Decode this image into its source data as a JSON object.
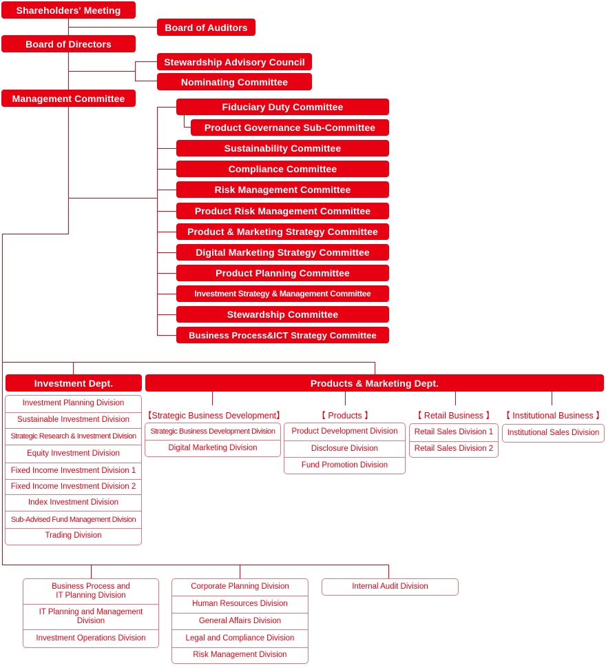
{
  "colors": {
    "accent": "#e60012",
    "line_light": "#e8757d",
    "background": "#ffffff"
  },
  "governance": {
    "shareholders": "Shareholders' Meeting",
    "auditors": "Board of Auditors",
    "directors": "Board of Directors",
    "stewardship_council": "Stewardship Advisory Council",
    "nominating": "Nominating Committee",
    "management": "Management Committee"
  },
  "committees": [
    "Fiduciary Duty Committee",
    "Product Governance Sub-Committee",
    "Sustainability Committee",
    "Compliance Committee",
    "Risk Management Committee",
    "Product Risk Management Committee",
    "Product & Marketing Strategy Committee",
    "Digital Marketing Strategy Committee",
    "Product Planning Committee",
    "Investment Strategy & Management Committee",
    "Stewardship Committee",
    "Business Process&ICT Strategy Committee"
  ],
  "investment_dept": {
    "title": "Investment Dept.",
    "divisions": [
      "Investment Planning Division",
      "Sustainable Investment Division",
      "Strategic Research & Investment Division",
      "Equity Investment Division",
      "Fixed Income Investment Division 1",
      "Fixed Income Investment Division 2",
      "Index Investment Division",
      "Sub-Advised Fund Management Division",
      "Trading Division"
    ]
  },
  "pm_dept": {
    "title": "Products & Marketing Dept.",
    "groups": [
      {
        "label": "【Strategic Business Development】",
        "divisions": [
          "Strategic Business Development Division",
          "Digital Marketing Division"
        ]
      },
      {
        "label": "【 Products 】",
        "divisions": [
          "Product Development Division",
          "Disclosure Division",
          "Fund Promotion Division"
        ]
      },
      {
        "label": "【 Retail Business 】",
        "divisions": [
          "Retail Sales Division 1",
          "Retail Sales Division 2"
        ]
      },
      {
        "label": "【 Institutional Business 】",
        "divisions": [
          "Institutional Sales Division"
        ]
      }
    ]
  },
  "bottom": {
    "it_group": [
      "Business Process and IT Planning Division",
      "IT Planning and Management Division",
      "Investment Operations Division"
    ],
    "corporate_group": [
      "Corporate Planning Division",
      "Human Resources Division",
      "General Affairs Division",
      "Legal and Compliance Division",
      "Risk Management Division"
    ],
    "audit": "Internal Audit Division"
  }
}
